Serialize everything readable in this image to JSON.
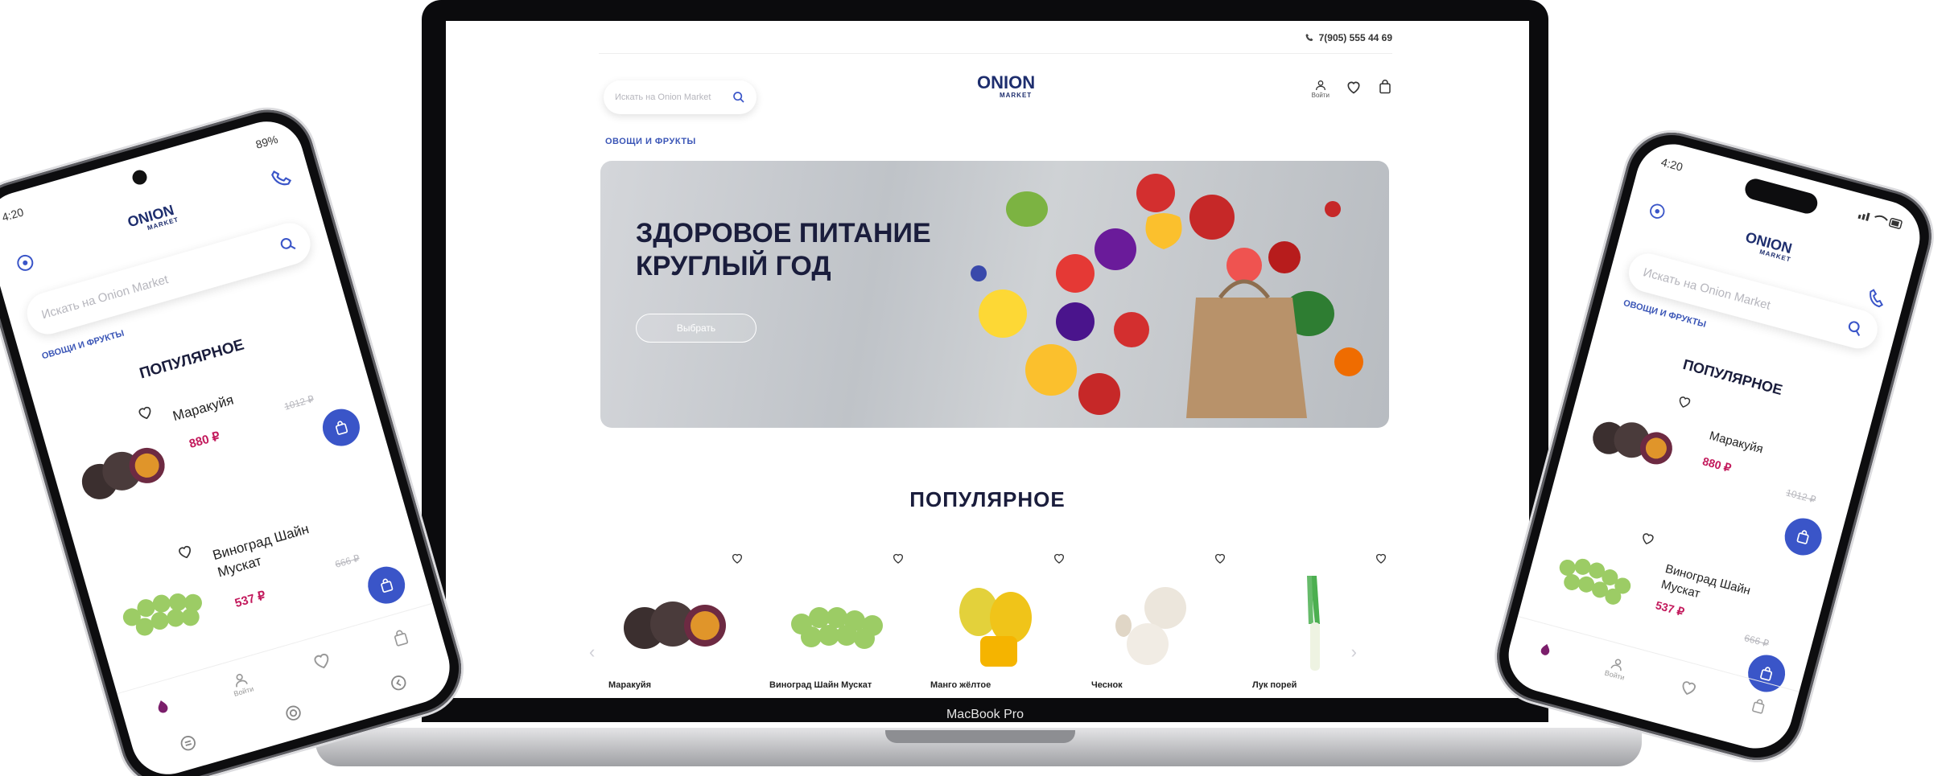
{
  "site": {
    "phone": "7(905) 555 44 69",
    "search_placeholder": "Искать на Onion Market",
    "logo_word": "ONION",
    "logo_sub": "MARKET",
    "login_label": "Войти",
    "breadcrumb": "ОВОЩИ И ФРУКТЫ",
    "hero_title": "ЗДОРОВОЕ ПИТАНИЕ КРУГЛЫЙ ГОД",
    "hero_button": "Выбрать",
    "popular_title": "ПОПУЛЯРНОЕ",
    "products": [
      {
        "name": "Маракуйя",
        "image": "passion-fruit"
      },
      {
        "name": "Виноград Шайн Мускат",
        "image": "grapes"
      },
      {
        "name": "Манго жёлтое",
        "image": "mango"
      },
      {
        "name": "Чеснок",
        "image": "garlic"
      },
      {
        "name": "Лук порей",
        "image": "leek"
      }
    ]
  },
  "laptop": {
    "model_label": "MacBook Pro"
  },
  "phone_left": {
    "time": "4:20",
    "battery": "89%",
    "search_placeholder": "Искать на Onion Market",
    "breadcrumb": "ОВОЩИ И ФРУКТЫ",
    "popular_title": "ПОПУЛЯРНОЕ",
    "login_label": "Войти",
    "products": [
      {
        "name": "Маракуйя",
        "price": "880 ₽",
        "old_price": "1012 ₽"
      },
      {
        "name": "Виноград Шайн Мускат",
        "price": "537 ₽",
        "old_price": "666 ₽"
      }
    ]
  },
  "phone_right": {
    "time": "4:20",
    "search_placeholder": "Искать на Onion Market",
    "breadcrumb": "ОВОЩИ И ФРУКТЫ",
    "popular_title": "ПОПУЛЯРНОЕ",
    "login_label": "Войти",
    "products": [
      {
        "name": "Маракуйя",
        "price": "880 ₽",
        "old_price": "1012 ₽"
      },
      {
        "name": "Виноград Шайн Мускат",
        "price": "537 ₽",
        "old_price": "666 ₽"
      }
    ]
  },
  "colors": {
    "brand_navy": "#1e2e6e",
    "brand_purple": "#7b1e6b",
    "accent_blue": "#3a55c8",
    "price_red": "#c2185b"
  }
}
